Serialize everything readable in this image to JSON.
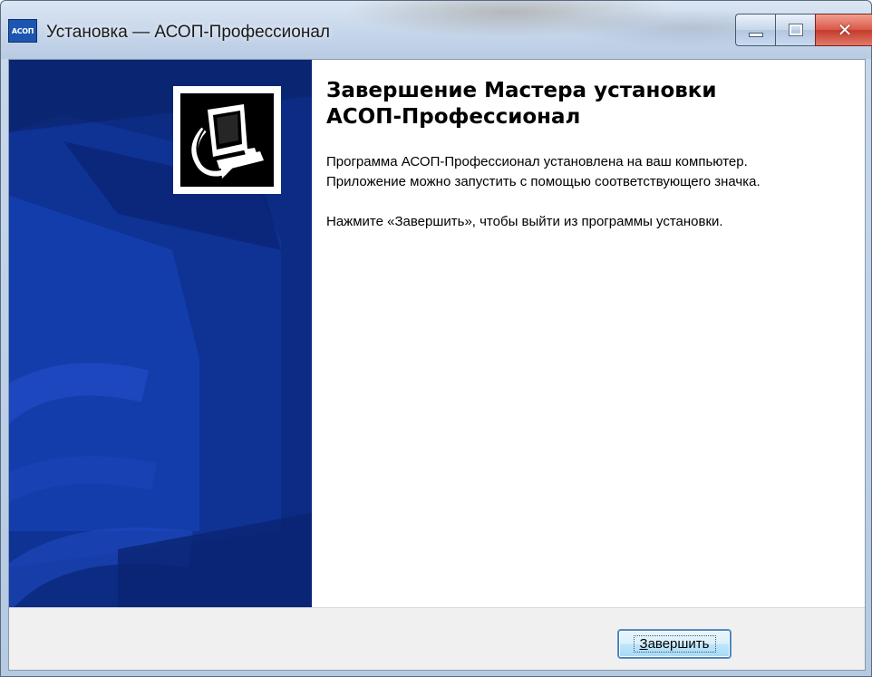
{
  "window": {
    "title": "Установка — АСОП-Профессионал",
    "app_icon_text": "АСОП"
  },
  "wizard": {
    "heading": "Завершение Мастера установки\nАСОП-Профессионал",
    "line1": "Программа АСОП-Профессионал установлена на ваш компьютер.",
    "line2": "Приложение можно запустить с помощью соответствующего значка.",
    "line3": "Нажмите «Завершить», чтобы выйти из программы установки."
  },
  "buttons": {
    "finish": "Завершить"
  },
  "colors": {
    "banner": "#0d2e8c",
    "button_border": "#3c7fb1",
    "close_button": "#c43b2c"
  },
  "icons": {
    "window_controls": [
      "minimize-icon",
      "maximize-icon",
      "close-icon"
    ],
    "wizard_logo": "computer-install-icon"
  }
}
